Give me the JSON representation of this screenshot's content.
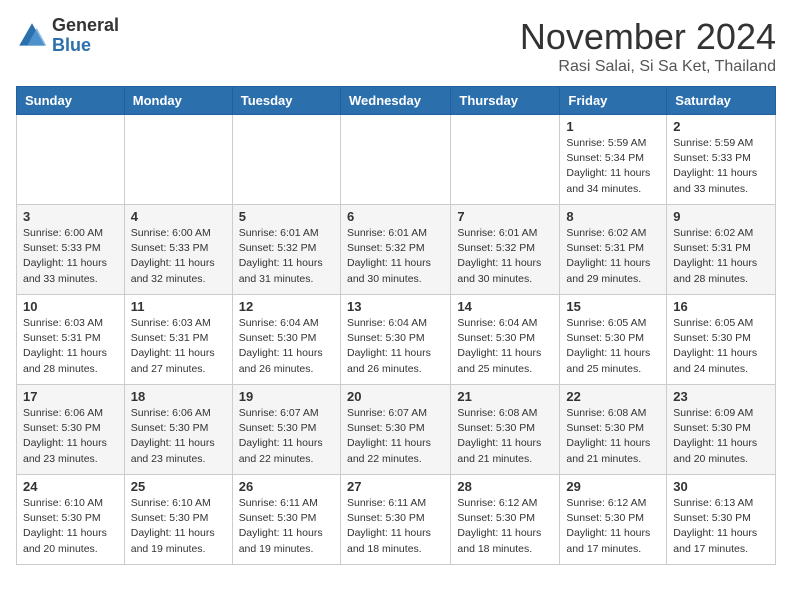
{
  "logo": {
    "general": "General",
    "blue": "Blue"
  },
  "header": {
    "month": "November 2024",
    "location": "Rasi Salai, Si Sa Ket, Thailand"
  },
  "weekdays": [
    "Sunday",
    "Monday",
    "Tuesday",
    "Wednesday",
    "Thursday",
    "Friday",
    "Saturday"
  ],
  "weeks": [
    [
      {
        "day": "",
        "info": ""
      },
      {
        "day": "",
        "info": ""
      },
      {
        "day": "",
        "info": ""
      },
      {
        "day": "",
        "info": ""
      },
      {
        "day": "",
        "info": ""
      },
      {
        "day": "1",
        "info": "Sunrise: 5:59 AM\nSunset: 5:34 PM\nDaylight: 11 hours\nand 34 minutes."
      },
      {
        "day": "2",
        "info": "Sunrise: 5:59 AM\nSunset: 5:33 PM\nDaylight: 11 hours\nand 33 minutes."
      }
    ],
    [
      {
        "day": "3",
        "info": "Sunrise: 6:00 AM\nSunset: 5:33 PM\nDaylight: 11 hours\nand 33 minutes."
      },
      {
        "day": "4",
        "info": "Sunrise: 6:00 AM\nSunset: 5:33 PM\nDaylight: 11 hours\nand 32 minutes."
      },
      {
        "day": "5",
        "info": "Sunrise: 6:01 AM\nSunset: 5:32 PM\nDaylight: 11 hours\nand 31 minutes."
      },
      {
        "day": "6",
        "info": "Sunrise: 6:01 AM\nSunset: 5:32 PM\nDaylight: 11 hours\nand 30 minutes."
      },
      {
        "day": "7",
        "info": "Sunrise: 6:01 AM\nSunset: 5:32 PM\nDaylight: 11 hours\nand 30 minutes."
      },
      {
        "day": "8",
        "info": "Sunrise: 6:02 AM\nSunset: 5:31 PM\nDaylight: 11 hours\nand 29 minutes."
      },
      {
        "day": "9",
        "info": "Sunrise: 6:02 AM\nSunset: 5:31 PM\nDaylight: 11 hours\nand 28 minutes."
      }
    ],
    [
      {
        "day": "10",
        "info": "Sunrise: 6:03 AM\nSunset: 5:31 PM\nDaylight: 11 hours\nand 28 minutes."
      },
      {
        "day": "11",
        "info": "Sunrise: 6:03 AM\nSunset: 5:31 PM\nDaylight: 11 hours\nand 27 minutes."
      },
      {
        "day": "12",
        "info": "Sunrise: 6:04 AM\nSunset: 5:30 PM\nDaylight: 11 hours\nand 26 minutes."
      },
      {
        "day": "13",
        "info": "Sunrise: 6:04 AM\nSunset: 5:30 PM\nDaylight: 11 hours\nand 26 minutes."
      },
      {
        "day": "14",
        "info": "Sunrise: 6:04 AM\nSunset: 5:30 PM\nDaylight: 11 hours\nand 25 minutes."
      },
      {
        "day": "15",
        "info": "Sunrise: 6:05 AM\nSunset: 5:30 PM\nDaylight: 11 hours\nand 25 minutes."
      },
      {
        "day": "16",
        "info": "Sunrise: 6:05 AM\nSunset: 5:30 PM\nDaylight: 11 hours\nand 24 minutes."
      }
    ],
    [
      {
        "day": "17",
        "info": "Sunrise: 6:06 AM\nSunset: 5:30 PM\nDaylight: 11 hours\nand 23 minutes."
      },
      {
        "day": "18",
        "info": "Sunrise: 6:06 AM\nSunset: 5:30 PM\nDaylight: 11 hours\nand 23 minutes."
      },
      {
        "day": "19",
        "info": "Sunrise: 6:07 AM\nSunset: 5:30 PM\nDaylight: 11 hours\nand 22 minutes."
      },
      {
        "day": "20",
        "info": "Sunrise: 6:07 AM\nSunset: 5:30 PM\nDaylight: 11 hours\nand 22 minutes."
      },
      {
        "day": "21",
        "info": "Sunrise: 6:08 AM\nSunset: 5:30 PM\nDaylight: 11 hours\nand 21 minutes."
      },
      {
        "day": "22",
        "info": "Sunrise: 6:08 AM\nSunset: 5:30 PM\nDaylight: 11 hours\nand 21 minutes."
      },
      {
        "day": "23",
        "info": "Sunrise: 6:09 AM\nSunset: 5:30 PM\nDaylight: 11 hours\nand 20 minutes."
      }
    ],
    [
      {
        "day": "24",
        "info": "Sunrise: 6:10 AM\nSunset: 5:30 PM\nDaylight: 11 hours\nand 20 minutes."
      },
      {
        "day": "25",
        "info": "Sunrise: 6:10 AM\nSunset: 5:30 PM\nDaylight: 11 hours\nand 19 minutes."
      },
      {
        "day": "26",
        "info": "Sunrise: 6:11 AM\nSunset: 5:30 PM\nDaylight: 11 hours\nand 19 minutes."
      },
      {
        "day": "27",
        "info": "Sunrise: 6:11 AM\nSunset: 5:30 PM\nDaylight: 11 hours\nand 18 minutes."
      },
      {
        "day": "28",
        "info": "Sunrise: 6:12 AM\nSunset: 5:30 PM\nDaylight: 11 hours\nand 18 minutes."
      },
      {
        "day": "29",
        "info": "Sunrise: 6:12 AM\nSunset: 5:30 PM\nDaylight: 11 hours\nand 17 minutes."
      },
      {
        "day": "30",
        "info": "Sunrise: 6:13 AM\nSunset: 5:30 PM\nDaylight: 11 hours\nand 17 minutes."
      }
    ]
  ]
}
